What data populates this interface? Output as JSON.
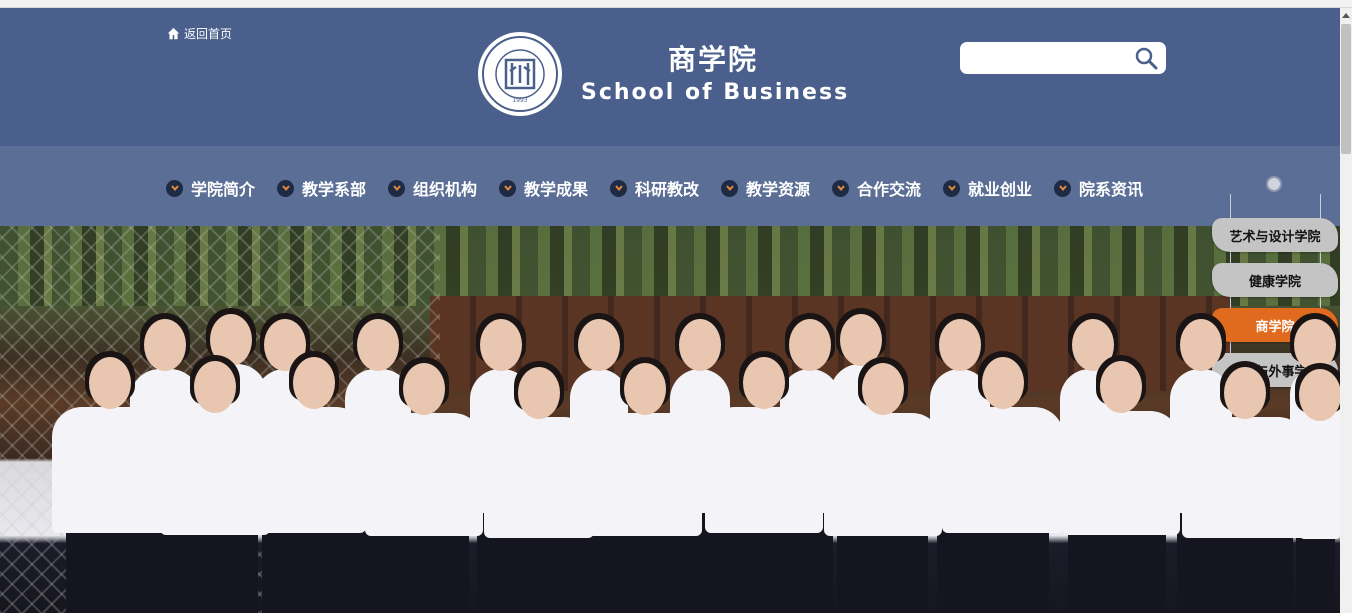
{
  "header": {
    "home_link": "返回首页",
    "title_cn": "商学院",
    "title_en": "School of Business",
    "search_placeholder": "",
    "logo_year": "1993"
  },
  "nav": {
    "items": [
      {
        "label": "学院简介"
      },
      {
        "label": "教学系部"
      },
      {
        "label": "组织机构"
      },
      {
        "label": "教学成果"
      },
      {
        "label": "科研教改"
      },
      {
        "label": "教学资源"
      },
      {
        "label": "合作交流"
      },
      {
        "label": "就业创业"
      },
      {
        "label": "院系资讯"
      }
    ]
  },
  "side_menu": {
    "items": [
      {
        "label": "艺术与设计学院",
        "active": false
      },
      {
        "label": "健康学院",
        "active": false
      },
      {
        "label": "商学院",
        "active": true
      },
      {
        "label": "人文与外事学院",
        "active": false
      }
    ]
  },
  "colors": {
    "header_bg": "#4a5f8c",
    "nav_bg": "#5b6e96",
    "active_accent": "#e06a1e",
    "side_button": "#c4c4c4"
  },
  "icons": [
    "home-icon",
    "search-icon",
    "chevron-down-icon",
    "college-logo"
  ]
}
